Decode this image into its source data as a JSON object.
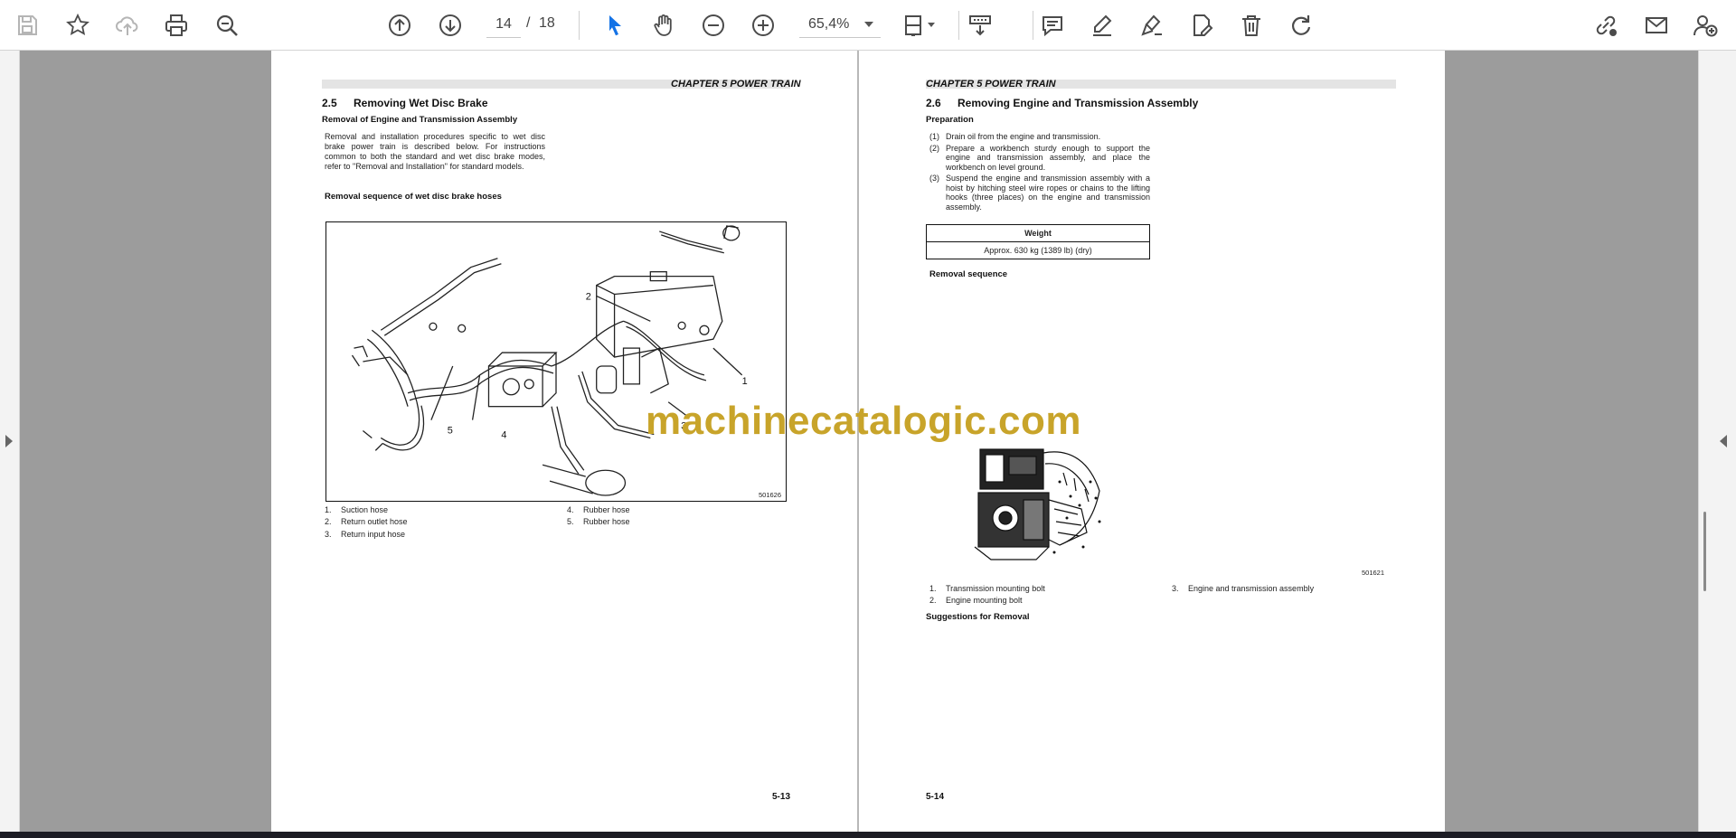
{
  "toolbar": {
    "page_current": "14",
    "page_separator": "/",
    "page_total": "18",
    "zoom": "65,4%",
    "icons": [
      "save-icon",
      "bookmark-star-icon",
      "cloud-upload-icon",
      "print-icon",
      "zoom-search-icon",
      "page-up-icon",
      "page-down-icon",
      "select-cursor-icon",
      "hand-pan-icon",
      "zoom-out-icon",
      "zoom-in-icon",
      "page-fit-icon",
      "scroll-mode-icon",
      "comment-icon",
      "highlight-pen-icon",
      "sign-pen-icon",
      "edit-file-icon",
      "delete-trash-icon",
      "undo-icon",
      "share-link-icon",
      "email-icon",
      "add-user-icon"
    ]
  },
  "left_page": {
    "chapter": "CHAPTER 5 POWER TRAIN",
    "section_number": "2.5",
    "section_title": "Removing Wet Disc Brake",
    "subheading": "Removal of Engine and Transmission Assembly",
    "paragraph": "Removal and installation procedures specific to wet disc brake power train is described below. For instructions common to both the standard and wet disc brake modes, refer to \"Removal and Installation\" for standard models.",
    "sequence_heading": "Removal sequence of wet disc brake hoses",
    "figure_code": "501626",
    "callouts": [
      "1",
      "2",
      "3",
      "4",
      "5"
    ],
    "legend_left": [
      {
        "n": "1.",
        "label": "Suction hose"
      },
      {
        "n": "2.",
        "label": "Return outlet hose"
      },
      {
        "n": "3.",
        "label": "Return input hose"
      }
    ],
    "legend_right": [
      {
        "n": "4.",
        "label": "Rubber hose"
      },
      {
        "n": "5.",
        "label": "Rubber hose"
      }
    ],
    "page_number": "5-13"
  },
  "right_page": {
    "chapter": "CHAPTER 5 POWER TRAIN",
    "section_number": "2.6",
    "section_title": "Removing Engine and Transmission Assembly",
    "subheading": "Preparation",
    "steps": [
      {
        "k": "(1)",
        "v": "Drain oil from the engine and transmission."
      },
      {
        "k": "(2)",
        "v": "Prepare a workbench sturdy enough to support the engine and transmission assembly, and place the workbench on level ground."
      },
      {
        "k": "(3)",
        "v": "Suspend the engine and transmission assembly with a hoist by hitching steel wire ropes or chains to the lifting hooks (three places) on the engine and transmission assembly."
      }
    ],
    "table_header": "Weight",
    "table_value": "Approx. 630 kg (1389 lb) (dry)",
    "removal_heading": "Removal sequence",
    "figure_code": "501621",
    "legend_left": [
      {
        "n": "1.",
        "label": "Transmission mounting bolt"
      },
      {
        "n": "2.",
        "label": "Engine mounting bolt"
      }
    ],
    "legend_right": [
      {
        "n": "3.",
        "label": "Engine and transmission assembly"
      }
    ],
    "suggestions_heading": "Suggestions for Removal",
    "page_number": "5-14"
  },
  "watermark": "machinecatalogic.com",
  "colors": {
    "accent_blue": "#1473e6",
    "icon_gray": "#4b4b4b",
    "watermark": "#c8a42a",
    "viewer_bg": "#9c9c9c"
  }
}
